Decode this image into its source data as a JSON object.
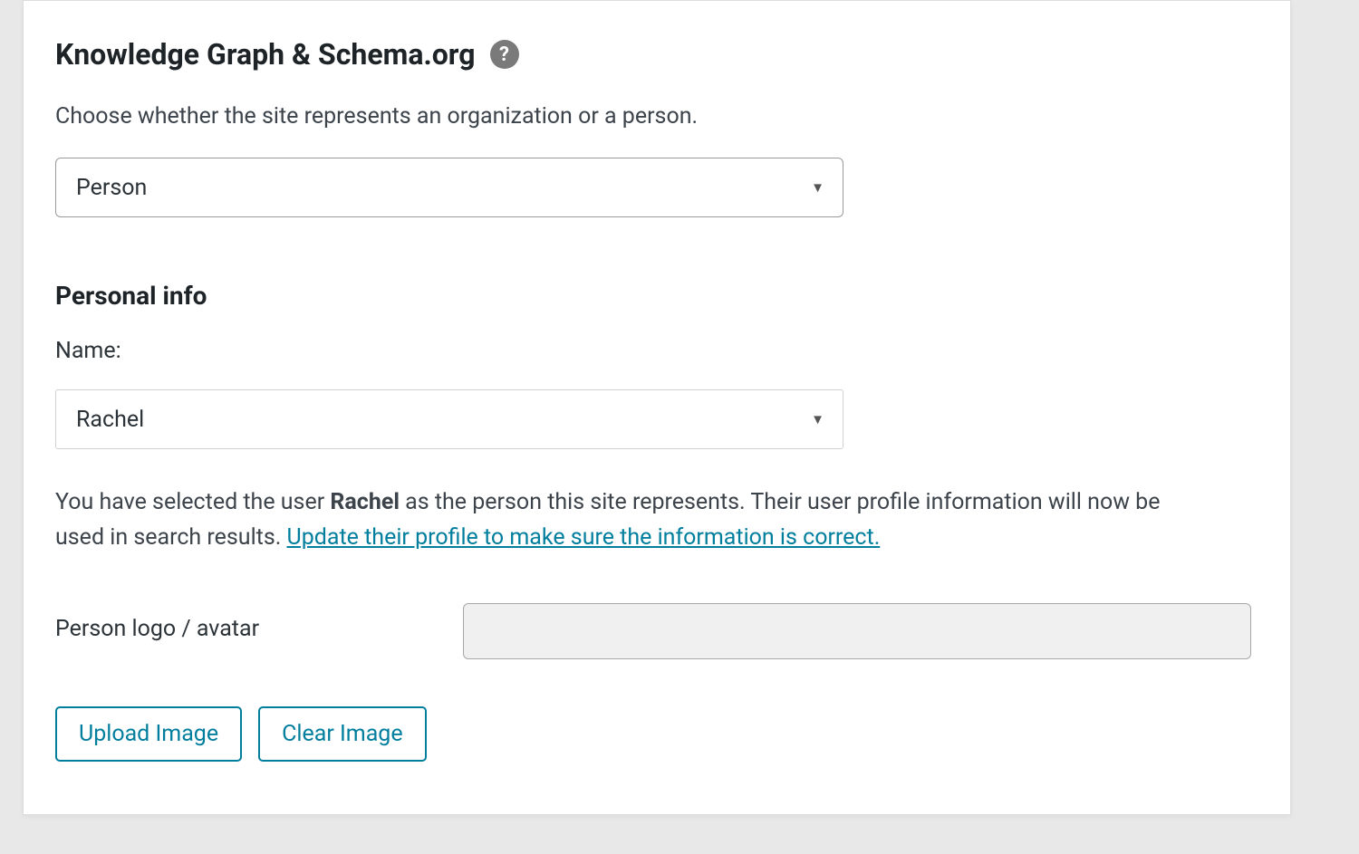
{
  "section": {
    "title": "Knowledge Graph & Schema.org",
    "description": "Choose whether the site represents an organization or a person."
  },
  "entity_type_select": {
    "value": "Person"
  },
  "personal_info": {
    "title": "Personal info",
    "name_label": "Name:",
    "name_select_value": "Rachel",
    "info_text_prefix": "You have selected the user ",
    "info_text_bold": "Rachel",
    "info_text_suffix": " as the person this site represents. Their user profile information will now be used in search results. ",
    "info_link_text": "Update their profile to make sure the information is correct."
  },
  "avatar": {
    "label": "Person logo / avatar",
    "upload_button": "Upload Image",
    "clear_button": "Clear Image"
  }
}
